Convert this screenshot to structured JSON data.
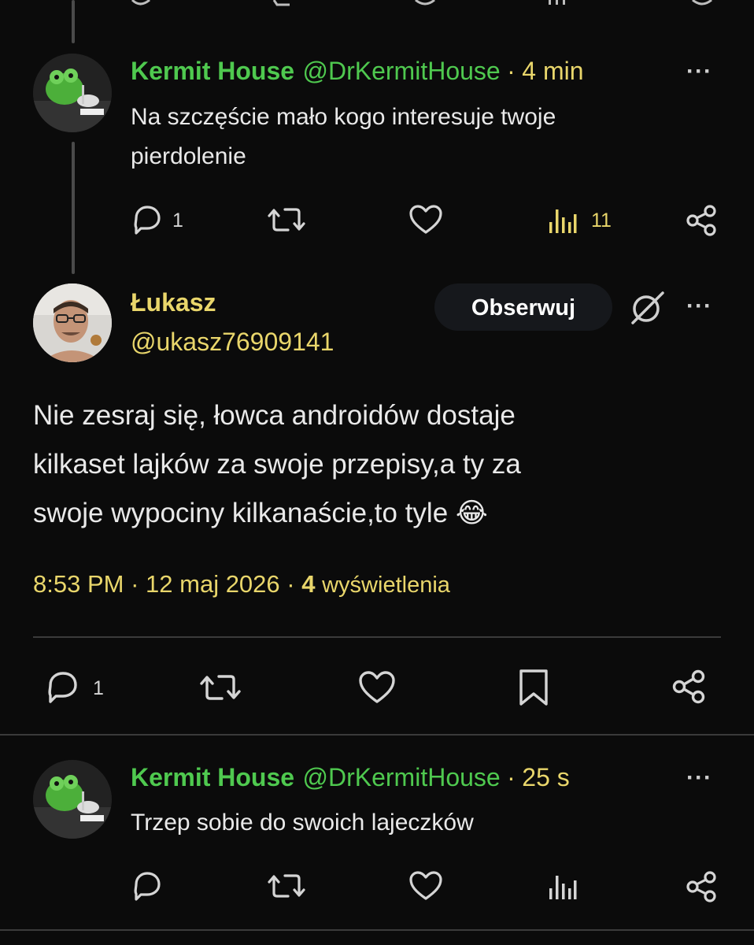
{
  "colors": {
    "background": "#0b0b0b",
    "name_green": "#4fc94f",
    "meta_yellow": "#e9d66b",
    "divider": "#3b3b3b"
  },
  "reply1": {
    "name": "Kermit House",
    "handle": "@DrKermitHouse",
    "separator": "·",
    "time": "4 min",
    "more": "···",
    "lines": [
      "Na szczęście mało kogo interesuje twoje",
      "pierdolenie"
    ],
    "replies_count": "1",
    "views_count": "11"
  },
  "main": {
    "name": "Łukasz",
    "handle": "@ukasz76909141",
    "follow_label": "Obserwuj",
    "more": "···",
    "lines": [
      "Nie zesraj się, łowca androidów dostaje",
      "kilkaset lajków za swoje przepisy,a ty za",
      "swoje wypociny kilkanaście,to tyle 😂"
    ],
    "time": "8:53 PM",
    "separator": "·",
    "date": "12 maj 2026",
    "views_count": "4",
    "views_label": "wyświetlenia",
    "replies_count": "1"
  },
  "reply2": {
    "name": "Kermit House",
    "handle": "@DrKermitHouse",
    "separator": "·",
    "time": "25 s",
    "more": "···",
    "text": "Trzep sobie do swoich lajeczków"
  },
  "icons": [
    "reply-icon",
    "retweet-icon",
    "like-icon",
    "views-icon",
    "share-icon",
    "bookmark-icon",
    "grok-icon"
  ]
}
